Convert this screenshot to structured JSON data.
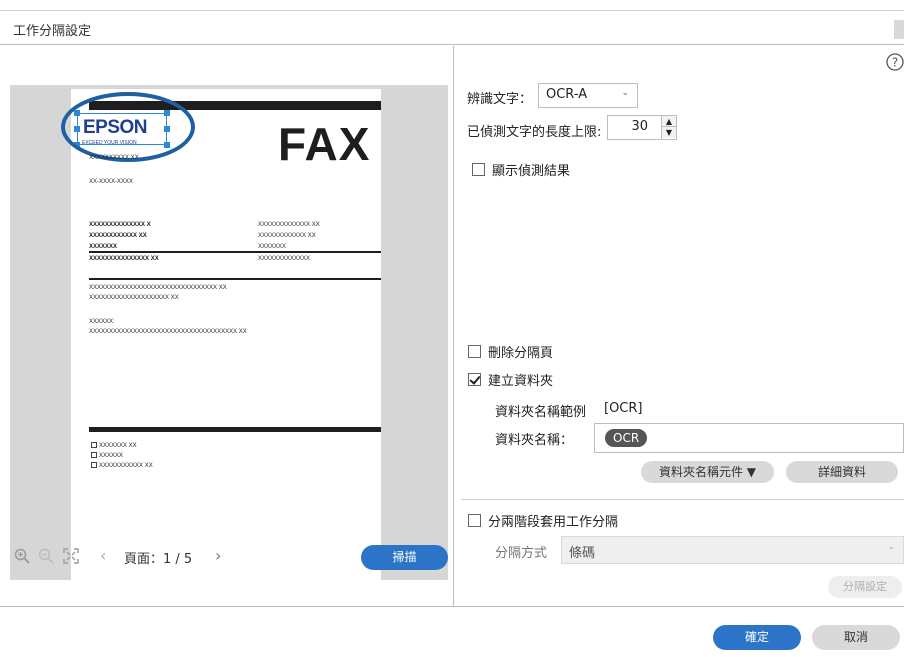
{
  "window": {
    "title": "工作分隔設定"
  },
  "preview": {
    "fax_label": "FAX",
    "logo_text": "EPSON",
    "logo_subtext": "EXCEED YOUR VISION",
    "header_lines": [
      "XXXXXXXXXX XX",
      "XX-XXXX-XXXX"
    ],
    "block_left": [
      "XXXXXXXXXXXXXX X",
      "XXXXXXXXXXXX XX",
      "XXXXXXX"
    ],
    "block_right": [
      "XXXXXXXXXXXXX XX",
      "XXXXXXXXXXXX XX",
      "XXXXXXX"
    ],
    "row_left": "XXXXXXXXXXXXXXX XX",
    "row_right": "XXXXXXXXXXXXX",
    "body_lines": [
      "XXXXXXXXXXXXXXXXXXXXXXXXXXXXXXXX XX",
      "XXXXXXXXXXXXXXXXXXXX XX",
      "XXXXXX:",
      "XXXXXXXXXXXXXXXXXXXXXXXXXXXXXXXXXXXXX XX"
    ],
    "checklist": [
      "XXXXXXX XX",
      "XXXXXX",
      "XXXXXXXXXXX XX"
    ]
  },
  "toolbar": {
    "zoom_in_icon": "zoom-in",
    "zoom_out_icon": "zoom-out",
    "fit_icon": "fit-page",
    "page_label": "頁面：1 / 5",
    "prev_glyph": "‹",
    "next_glyph": "›",
    "scan_label": "掃描"
  },
  "settings": {
    "ocr_label": "辨識文字：",
    "ocr_value": "OCR-A",
    "length_label": "已偵測文字的長度上限:",
    "length_value": "30",
    "show_results_label": "顯示偵測結果",
    "show_results_checked": false,
    "delete_sep_label": "刪除分隔頁",
    "delete_sep_checked": false,
    "create_folder_label": "建立資料夾",
    "create_folder_checked": true,
    "folder_example_label": "資料夾名稱範例",
    "folder_example_value": "[OCR]",
    "folder_name_label": "資料夾名稱：",
    "folder_name_tag": "OCR",
    "folder_elements_button": "資料夾名稱元件 ▼",
    "details_button": "詳細資料",
    "two_stage_label": "分兩階段套用工作分隔",
    "two_stage_checked": false,
    "sep_method_label": "分隔方式",
    "sep_method_value": "條碼",
    "sep_settings_button": "分隔設定"
  },
  "footer": {
    "ok_label": "確定",
    "cancel_label": "取消"
  },
  "colors": {
    "accent": "#2b74c7",
    "logo_blue": "#1e3f92",
    "highlight_ring": "#1f5fa3"
  }
}
